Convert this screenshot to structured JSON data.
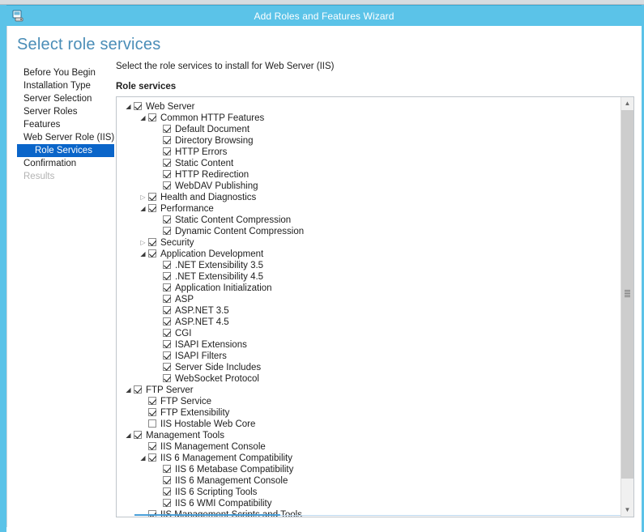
{
  "window": {
    "title": "Add Roles and Features Wizard",
    "icon": "server-wizard-icon",
    "accent_color": "#5bc3e8"
  },
  "page": {
    "heading": "Select role services",
    "heading_color": "#4a8db7"
  },
  "sidebar": {
    "items": [
      {
        "label": "Before You Begin",
        "state": "normal",
        "indent": 0
      },
      {
        "label": "Installation Type",
        "state": "normal",
        "indent": 0
      },
      {
        "label": "Server Selection",
        "state": "normal",
        "indent": 0
      },
      {
        "label": "Server Roles",
        "state": "normal",
        "indent": 0
      },
      {
        "label": "Features",
        "state": "normal",
        "indent": 0
      },
      {
        "label": "Web Server Role (IIS)",
        "state": "normal",
        "indent": 0
      },
      {
        "label": "Role Services",
        "state": "selected",
        "indent": 1
      },
      {
        "label": "Confirmation",
        "state": "normal",
        "indent": 0
      },
      {
        "label": "Results",
        "state": "disabled",
        "indent": 0
      }
    ],
    "selected_color": "#0a65c9"
  },
  "main": {
    "instruction": "Select the role services to install for Web Server (IIS)",
    "sublabel": "Role services"
  },
  "tree": {
    "rows": [
      {
        "label": "Web Server",
        "depth": 0,
        "checked": true,
        "twisty": "expanded"
      },
      {
        "label": "Common HTTP Features",
        "depth": 1,
        "checked": true,
        "twisty": "expanded"
      },
      {
        "label": "Default Document",
        "depth": 2,
        "checked": true,
        "twisty": "none"
      },
      {
        "label": "Directory Browsing",
        "depth": 2,
        "checked": true,
        "twisty": "none"
      },
      {
        "label": "HTTP Errors",
        "depth": 2,
        "checked": true,
        "twisty": "none"
      },
      {
        "label": "Static Content",
        "depth": 2,
        "checked": true,
        "twisty": "none"
      },
      {
        "label": "HTTP Redirection",
        "depth": 2,
        "checked": true,
        "twisty": "none"
      },
      {
        "label": "WebDAV Publishing",
        "depth": 2,
        "checked": true,
        "twisty": "none"
      },
      {
        "label": "Health and Diagnostics",
        "depth": 1,
        "checked": true,
        "twisty": "collapsed"
      },
      {
        "label": "Performance",
        "depth": 1,
        "checked": true,
        "twisty": "expanded"
      },
      {
        "label": "Static Content Compression",
        "depth": 2,
        "checked": true,
        "twisty": "none"
      },
      {
        "label": "Dynamic Content Compression",
        "depth": 2,
        "checked": true,
        "twisty": "none"
      },
      {
        "label": "Security",
        "depth": 1,
        "checked": true,
        "twisty": "collapsed"
      },
      {
        "label": "Application Development",
        "depth": 1,
        "checked": true,
        "twisty": "expanded"
      },
      {
        "label": ".NET Extensibility 3.5",
        "depth": 2,
        "checked": true,
        "twisty": "none"
      },
      {
        "label": ".NET Extensibility 4.5",
        "depth": 2,
        "checked": true,
        "twisty": "none"
      },
      {
        "label": "Application Initialization",
        "depth": 2,
        "checked": true,
        "twisty": "none"
      },
      {
        "label": "ASP",
        "depth": 2,
        "checked": true,
        "twisty": "none"
      },
      {
        "label": "ASP.NET 3.5",
        "depth": 2,
        "checked": true,
        "twisty": "none"
      },
      {
        "label": "ASP.NET 4.5",
        "depth": 2,
        "checked": true,
        "twisty": "none"
      },
      {
        "label": "CGI",
        "depth": 2,
        "checked": true,
        "twisty": "none"
      },
      {
        "label": "ISAPI Extensions",
        "depth": 2,
        "checked": true,
        "twisty": "none"
      },
      {
        "label": "ISAPI Filters",
        "depth": 2,
        "checked": true,
        "twisty": "none"
      },
      {
        "label": "Server Side Includes",
        "depth": 2,
        "checked": true,
        "twisty": "none"
      },
      {
        "label": "WebSocket Protocol",
        "depth": 2,
        "checked": true,
        "twisty": "none"
      },
      {
        "label": "FTP Server",
        "depth": 0,
        "checked": true,
        "twisty": "expanded"
      },
      {
        "label": "FTP Service",
        "depth": 1,
        "checked": true,
        "twisty": "none"
      },
      {
        "label": "FTP Extensibility",
        "depth": 1,
        "checked": true,
        "twisty": "none"
      },
      {
        "label": "IIS Hostable Web Core",
        "depth": 1,
        "checked": false,
        "twisty": "none"
      },
      {
        "label": "Management Tools",
        "depth": 0,
        "checked": true,
        "twisty": "expanded"
      },
      {
        "label": "IIS Management Console",
        "depth": 1,
        "checked": true,
        "twisty": "none"
      },
      {
        "label": "IIS 6 Management Compatibility",
        "depth": 1,
        "checked": true,
        "twisty": "expanded"
      },
      {
        "label": "IIS 6 Metabase Compatibility",
        "depth": 2,
        "checked": true,
        "twisty": "none"
      },
      {
        "label": "IIS 6 Management Console",
        "depth": 2,
        "checked": true,
        "twisty": "none"
      },
      {
        "label": "IIS 6 Scripting Tools",
        "depth": 2,
        "checked": true,
        "twisty": "none"
      },
      {
        "label": "IIS 6 WMI Compatibility",
        "depth": 2,
        "checked": true,
        "twisty": "none"
      },
      {
        "label": "IIS Management Scripts and Tools",
        "depth": 1,
        "checked": true,
        "twisty": "none"
      }
    ],
    "glyphs": {
      "expanded": "◢",
      "collapsed": "▷"
    }
  },
  "scrollbar": {
    "up_glyph": "▲",
    "down_glyph": "▼"
  }
}
